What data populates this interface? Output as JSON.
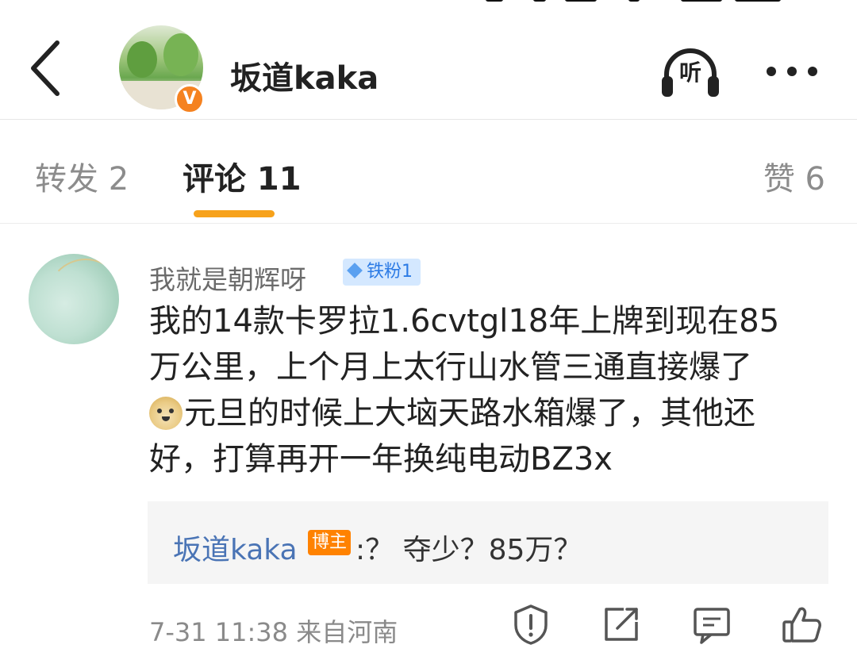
{
  "header": {
    "title": "坂道kaka",
    "verified_mark": "V",
    "listen_label": "听"
  },
  "tabs": [
    {
      "label": "转发 2"
    },
    {
      "label": "评论 11"
    },
    {
      "label": "赞 6"
    }
  ],
  "comment": {
    "user": "我就是朝辉呀",
    "fan_badge": "铁粉1",
    "lines": [
      "我的14款卡罗拉1.6cvtgl18年上牌到现在85",
      "万公里，上个月上太行山水管三通直接爆了",
      "元旦的时候上大垴天路水箱爆了，其他还",
      "好，打算再开一年换纯电动BZ3x"
    ],
    "emoji": "doge",
    "reply": {
      "user": "坂道kaka",
      "badge": "博主",
      "text": ":？ 夺少？85万？"
    },
    "timestamp": "7-31 11:38",
    "location": "来自河南"
  },
  "icons": {
    "back": "chevron-left-icon",
    "listen": "headphones-icon",
    "more": "more-dots-icon",
    "report": "report-shield-icon",
    "share": "share-icon",
    "comment": "comment-icon",
    "like": "thumbs-up-icon"
  },
  "colors": {
    "accent": "#f7a21b",
    "link": "#4a74b5",
    "verified": "#f58220",
    "blogger_badge": "#ff8200",
    "fan_badge_bg": "#d4e8ff"
  }
}
